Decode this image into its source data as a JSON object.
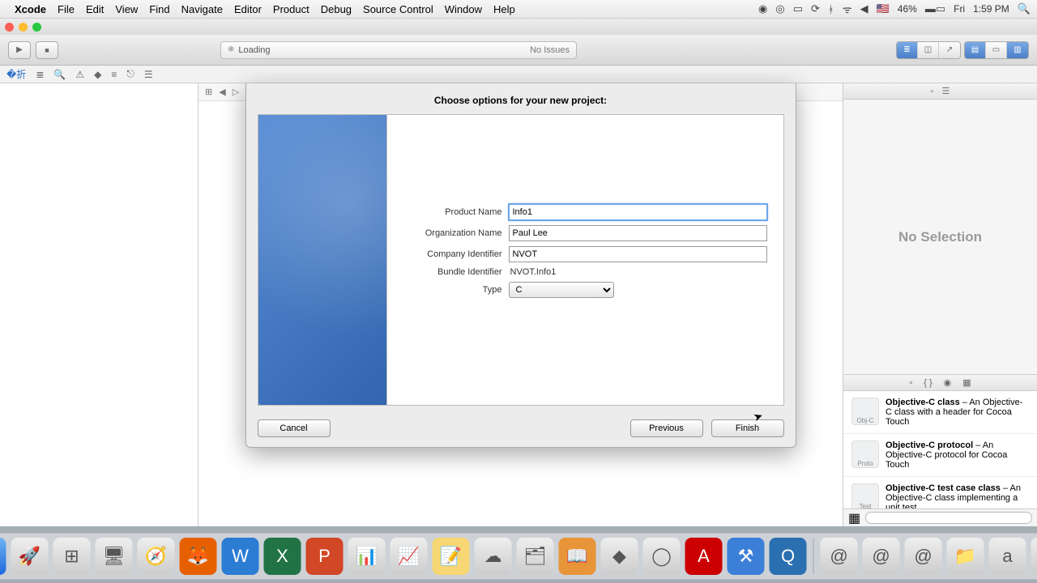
{
  "menubar": {
    "app": "Xcode",
    "items": [
      "File",
      "Edit",
      "View",
      "Find",
      "Navigate",
      "Editor",
      "Product",
      "Debug",
      "Source Control",
      "Window",
      "Help"
    ],
    "right": {
      "battery": "46%",
      "day": "Fri",
      "time": "1:59 PM",
      "flag": "🇺🇸"
    }
  },
  "toolbar": {
    "status_loading": "Loading",
    "status_issues": "No Issues"
  },
  "sheet": {
    "title": "Choose options for your new project:",
    "fields": {
      "product_name_label": "Product Name",
      "product_name_value": "Info1",
      "org_name_label": "Organization Name",
      "org_name_value": "Paul Lee",
      "company_id_label": "Company Identifier",
      "company_id_value": "NVOT",
      "bundle_id_label": "Bundle Identifier",
      "bundle_id_value": "NVOT.Info1",
      "type_label": "Type",
      "type_value": "C"
    },
    "buttons": {
      "cancel": "Cancel",
      "previous": "Previous",
      "finish": "Finish"
    }
  },
  "inspector": {
    "no_selection": "No Selection",
    "library": [
      {
        "title": "Objective-C class",
        "desc": " – An Objective-C class with a header for Cocoa Touch",
        "tag": "Obj-C"
      },
      {
        "title": "Objective-C protocol",
        "desc": " – An Objective-C protocol for Cocoa Touch",
        "tag": "Proto"
      },
      {
        "title": "Objective-C test case class",
        "desc": " – An Objective-C class implementing a unit test",
        "tag": "Test"
      }
    ]
  }
}
